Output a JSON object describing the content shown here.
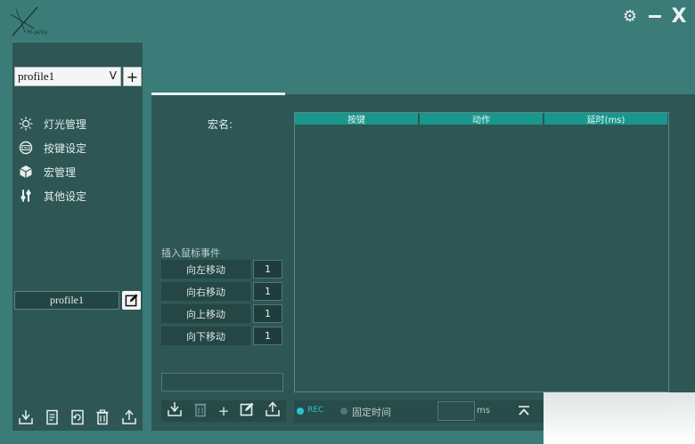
{
  "app": {
    "logo_text": "Hi-Jerky"
  },
  "window": {
    "gear": "⚙",
    "close": "X"
  },
  "sidebar": {
    "profile_select_value": "profile1",
    "profile_select_chevron": "V",
    "add_label": "+",
    "items": [
      {
        "label": "灯光管理",
        "icon": "bulb-icon"
      },
      {
        "label": "按键设定",
        "icon": "keyboard-icon"
      },
      {
        "label": "宏管理",
        "icon": "cube-icon"
      },
      {
        "label": "其他设定",
        "icon": "sliders-icon"
      }
    ],
    "profile_name": "profile1",
    "bottom_icons": [
      "import-icon",
      "document-icon",
      "refresh-icon",
      "trash-icon",
      "export-icon"
    ]
  },
  "macro": {
    "name_label": "宏名:",
    "table": {
      "columns": [
        "按键",
        "动作",
        "延时(ms)"
      ],
      "rows": []
    },
    "insert_mouse_label": "插入鼠标事件",
    "mouse_events": [
      {
        "label": "向左移动",
        "value": "1"
      },
      {
        "label": "向右移动",
        "value": "1"
      },
      {
        "label": "向上移动",
        "value": "1"
      },
      {
        "label": "向下移动",
        "value": "1"
      }
    ],
    "tools": [
      "import-icon",
      "trash-icon",
      "add-icon",
      "edit-icon",
      "export-icon"
    ],
    "tools_add": "+",
    "rec_label": "REC",
    "fixed_time_label": "固定时间",
    "delay_unit": "ms",
    "up_label": "⌅"
  },
  "colors": {
    "background": "#3b7c79",
    "panel": "#2d5654",
    "table_header": "#19978d",
    "accent": "#2cc2cf"
  }
}
